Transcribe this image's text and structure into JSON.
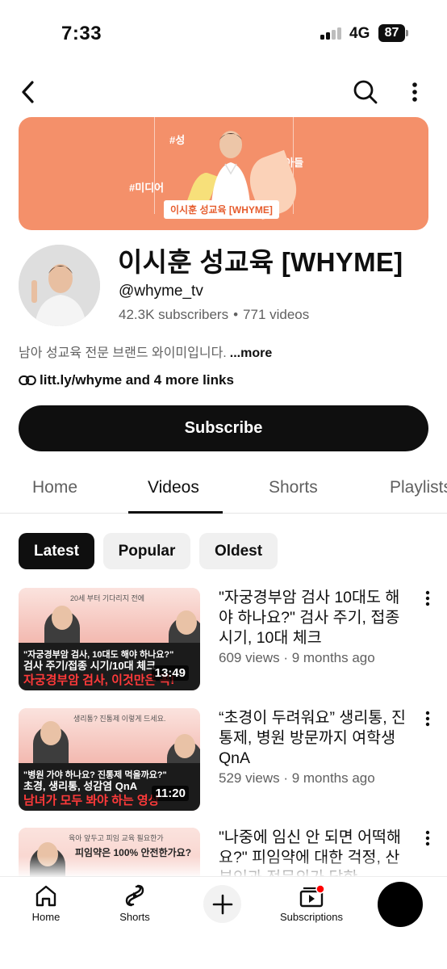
{
  "status": {
    "time": "7:33",
    "network": "4G",
    "battery": "87"
  },
  "banner": {
    "tag1": "#성",
    "tag2": "#아들",
    "tag3": "#미디어",
    "caption": "이시훈 성교육 [WHYME]",
    "color": "#f4906a"
  },
  "channel": {
    "name": "이시훈 성교육 [WHYME]",
    "handle": "@whyme_tv",
    "subscribers": "42.3K subscribers",
    "videos": "771 videos",
    "separator": "•",
    "description": "남아 성교육 전문 브랜드 와이미입니다.",
    "more_label": "...more",
    "links": "litt.ly/whyme and 4 more links",
    "subscribe_label": "Subscribe"
  },
  "tabs": [
    "Home",
    "Videos",
    "Shorts",
    "Playlists"
  ],
  "active_tab": "Videos",
  "filters": [
    "Latest",
    "Popular",
    "Oldest"
  ],
  "active_filter": "Latest",
  "videos": [
    {
      "title": "\"자궁경부암 검사 10대도 해야 하나요?\" 검사 주기, 접종 시기, 10대 체크",
      "meta": "609 views · 9 months ago",
      "duration": "13:49",
      "thumb_top": "20세 부터 기다리지 전에",
      "thumb_line1": "\"자궁경부암 검사, 10대도 해야 하나요?\"",
      "thumb_line2": "검사 주기/접종 시기/10대 체크",
      "thumb_line3": "자궁경부암 검사, 이것만은 꼭!"
    },
    {
      "title": "“초경이 두려워요” 생리통, 진통제, 병원 방문까지 여학생 QnA",
      "meta": "529 views · 9 months ago",
      "duration": "11:20",
      "thumb_top": "생리통? 진통제 이렇게 드세요.",
      "thumb_line1": "\"병원 가야 하나요? 진통제 먹을까요?\"",
      "thumb_line2": "초경, 생리통, 성감염 QnA",
      "thumb_line3": "남녀가 모두 봐야 하는 영상"
    },
    {
      "title": "\"나중에 임신 안 되면 어떡해요?\" 피임약에 대한 걱정, 산부인과 전문의가 답한",
      "meta": "",
      "duration": "",
      "thumb_top": "육아 앞두고 피임 교육 필요한가",
      "thumb_line1": "피임약은 100% 안전한가요?",
      "thumb_line2": "",
      "thumb_line3": ""
    }
  ],
  "bottom_nav": {
    "home": "Home",
    "shorts": "Shorts",
    "subscriptions": "Subscriptions"
  },
  "accent": "#0f0f0f",
  "notification_dot": "#ff0000"
}
